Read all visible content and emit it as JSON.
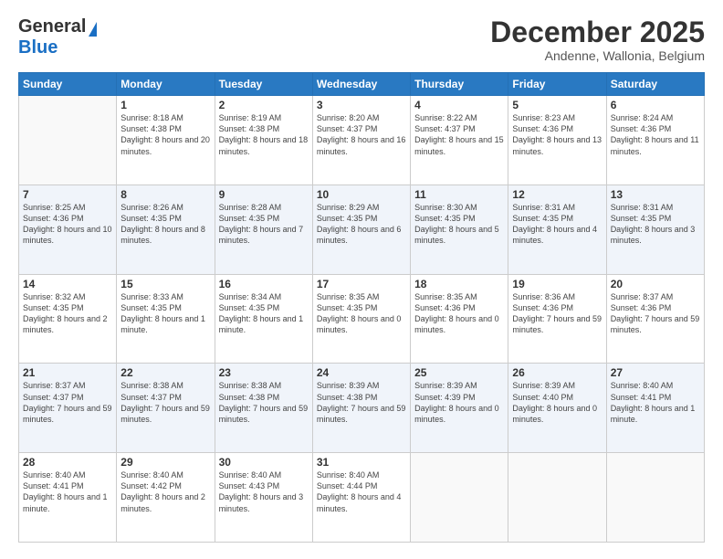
{
  "logo": {
    "general": "General",
    "blue": "Blue"
  },
  "header": {
    "month_title": "December 2025",
    "location": "Andenne, Wallonia, Belgium"
  },
  "days": [
    "Sunday",
    "Monday",
    "Tuesday",
    "Wednesday",
    "Thursday",
    "Friday",
    "Saturday"
  ],
  "weeks": [
    [
      {
        "date": "",
        "sunrise": "",
        "sunset": "",
        "daylight": ""
      },
      {
        "date": "1",
        "sunrise": "Sunrise: 8:18 AM",
        "sunset": "Sunset: 4:38 PM",
        "daylight": "Daylight: 8 hours and 20 minutes."
      },
      {
        "date": "2",
        "sunrise": "Sunrise: 8:19 AM",
        "sunset": "Sunset: 4:38 PM",
        "daylight": "Daylight: 8 hours and 18 minutes."
      },
      {
        "date": "3",
        "sunrise": "Sunrise: 8:20 AM",
        "sunset": "Sunset: 4:37 PM",
        "daylight": "Daylight: 8 hours and 16 minutes."
      },
      {
        "date": "4",
        "sunrise": "Sunrise: 8:22 AM",
        "sunset": "Sunset: 4:37 PM",
        "daylight": "Daylight: 8 hours and 15 minutes."
      },
      {
        "date": "5",
        "sunrise": "Sunrise: 8:23 AM",
        "sunset": "Sunset: 4:36 PM",
        "daylight": "Daylight: 8 hours and 13 minutes."
      },
      {
        "date": "6",
        "sunrise": "Sunrise: 8:24 AM",
        "sunset": "Sunset: 4:36 PM",
        "daylight": "Daylight: 8 hours and 11 minutes."
      }
    ],
    [
      {
        "date": "7",
        "sunrise": "Sunrise: 8:25 AM",
        "sunset": "Sunset: 4:36 PM",
        "daylight": "Daylight: 8 hours and 10 minutes."
      },
      {
        "date": "8",
        "sunrise": "Sunrise: 8:26 AM",
        "sunset": "Sunset: 4:35 PM",
        "daylight": "Daylight: 8 hours and 8 minutes."
      },
      {
        "date": "9",
        "sunrise": "Sunrise: 8:28 AM",
        "sunset": "Sunset: 4:35 PM",
        "daylight": "Daylight: 8 hours and 7 minutes."
      },
      {
        "date": "10",
        "sunrise": "Sunrise: 8:29 AM",
        "sunset": "Sunset: 4:35 PM",
        "daylight": "Daylight: 8 hours and 6 minutes."
      },
      {
        "date": "11",
        "sunrise": "Sunrise: 8:30 AM",
        "sunset": "Sunset: 4:35 PM",
        "daylight": "Daylight: 8 hours and 5 minutes."
      },
      {
        "date": "12",
        "sunrise": "Sunrise: 8:31 AM",
        "sunset": "Sunset: 4:35 PM",
        "daylight": "Daylight: 8 hours and 4 minutes."
      },
      {
        "date": "13",
        "sunrise": "Sunrise: 8:31 AM",
        "sunset": "Sunset: 4:35 PM",
        "daylight": "Daylight: 8 hours and 3 minutes."
      }
    ],
    [
      {
        "date": "14",
        "sunrise": "Sunrise: 8:32 AM",
        "sunset": "Sunset: 4:35 PM",
        "daylight": "Daylight: 8 hours and 2 minutes."
      },
      {
        "date": "15",
        "sunrise": "Sunrise: 8:33 AM",
        "sunset": "Sunset: 4:35 PM",
        "daylight": "Daylight: 8 hours and 1 minute."
      },
      {
        "date": "16",
        "sunrise": "Sunrise: 8:34 AM",
        "sunset": "Sunset: 4:35 PM",
        "daylight": "Daylight: 8 hours and 1 minute."
      },
      {
        "date": "17",
        "sunrise": "Sunrise: 8:35 AM",
        "sunset": "Sunset: 4:35 PM",
        "daylight": "Daylight: 8 hours and 0 minutes."
      },
      {
        "date": "18",
        "sunrise": "Sunrise: 8:35 AM",
        "sunset": "Sunset: 4:36 PM",
        "daylight": "Daylight: 8 hours and 0 minutes."
      },
      {
        "date": "19",
        "sunrise": "Sunrise: 8:36 AM",
        "sunset": "Sunset: 4:36 PM",
        "daylight": "Daylight: 7 hours and 59 minutes."
      },
      {
        "date": "20",
        "sunrise": "Sunrise: 8:37 AM",
        "sunset": "Sunset: 4:36 PM",
        "daylight": "Daylight: 7 hours and 59 minutes."
      }
    ],
    [
      {
        "date": "21",
        "sunrise": "Sunrise: 8:37 AM",
        "sunset": "Sunset: 4:37 PM",
        "daylight": "Daylight: 7 hours and 59 minutes."
      },
      {
        "date": "22",
        "sunrise": "Sunrise: 8:38 AM",
        "sunset": "Sunset: 4:37 PM",
        "daylight": "Daylight: 7 hours and 59 minutes."
      },
      {
        "date": "23",
        "sunrise": "Sunrise: 8:38 AM",
        "sunset": "Sunset: 4:38 PM",
        "daylight": "Daylight: 7 hours and 59 minutes."
      },
      {
        "date": "24",
        "sunrise": "Sunrise: 8:39 AM",
        "sunset": "Sunset: 4:38 PM",
        "daylight": "Daylight: 7 hours and 59 minutes."
      },
      {
        "date": "25",
        "sunrise": "Sunrise: 8:39 AM",
        "sunset": "Sunset: 4:39 PM",
        "daylight": "Daylight: 8 hours and 0 minutes."
      },
      {
        "date": "26",
        "sunrise": "Sunrise: 8:39 AM",
        "sunset": "Sunset: 4:40 PM",
        "daylight": "Daylight: 8 hours and 0 minutes."
      },
      {
        "date": "27",
        "sunrise": "Sunrise: 8:40 AM",
        "sunset": "Sunset: 4:41 PM",
        "daylight": "Daylight: 8 hours and 1 minute."
      }
    ],
    [
      {
        "date": "28",
        "sunrise": "Sunrise: 8:40 AM",
        "sunset": "Sunset: 4:41 PM",
        "daylight": "Daylight: 8 hours and 1 minute."
      },
      {
        "date": "29",
        "sunrise": "Sunrise: 8:40 AM",
        "sunset": "Sunset: 4:42 PM",
        "daylight": "Daylight: 8 hours and 2 minutes."
      },
      {
        "date": "30",
        "sunrise": "Sunrise: 8:40 AM",
        "sunset": "Sunset: 4:43 PM",
        "daylight": "Daylight: 8 hours and 3 minutes."
      },
      {
        "date": "31",
        "sunrise": "Sunrise: 8:40 AM",
        "sunset": "Sunset: 4:44 PM",
        "daylight": "Daylight: 8 hours and 4 minutes."
      },
      {
        "date": "",
        "sunrise": "",
        "sunset": "",
        "daylight": ""
      },
      {
        "date": "",
        "sunrise": "",
        "sunset": "",
        "daylight": ""
      },
      {
        "date": "",
        "sunrise": "",
        "sunset": "",
        "daylight": ""
      }
    ]
  ]
}
